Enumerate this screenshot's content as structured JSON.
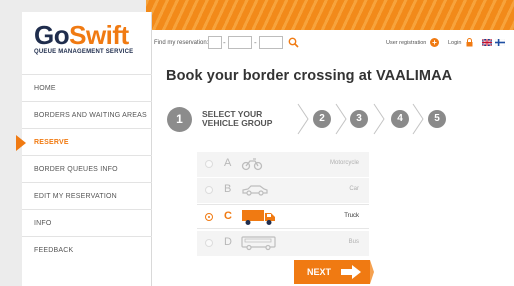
{
  "logo": {
    "go": "Go",
    "swift": "Swift",
    "subtitle": "QUEUE MANAGEMENT SERVICE"
  },
  "colors": {
    "accent": "#f07a12",
    "brand_dark": "#1f2d4d",
    "stripe_light": "#f7a33c"
  },
  "menu": {
    "items": [
      {
        "label": "HOME",
        "active": false
      },
      {
        "label": "BORDERS AND WAITING AREAS",
        "active": false
      },
      {
        "label": "RESERVE",
        "active": true
      },
      {
        "label": "BORDER QUEUES INFO",
        "active": false
      },
      {
        "label": "EDIT MY RESERVATION",
        "active": false
      },
      {
        "label": "INFO",
        "active": false
      },
      {
        "label": "FEEDBACK",
        "active": false
      }
    ]
  },
  "header": {
    "find_label": "Find my reservation:",
    "user_registration": "User registration",
    "login": "Login",
    "icons": [
      "search-icon",
      "plus-icon",
      "lock-icon",
      "uk-flag-icon",
      "finnish-flag-icon"
    ]
  },
  "page": {
    "title": "Book your border crossing at VAALIMAA"
  },
  "steps": {
    "current": {
      "number": "1",
      "label_line1": "SELECT YOUR",
      "label_line2": "VEHICLE GROUP"
    },
    "upcoming": [
      "2",
      "3",
      "4",
      "5"
    ]
  },
  "vehicles": [
    {
      "letter": "A",
      "name": "Motorcycle",
      "icon": "motorcycle-icon",
      "selected": false
    },
    {
      "letter": "B",
      "name": "Car",
      "icon": "car-icon",
      "selected": false
    },
    {
      "letter": "C",
      "name": "Truck",
      "icon": "truck-icon",
      "selected": true
    },
    {
      "letter": "D",
      "name": "Bus",
      "icon": "bus-icon",
      "selected": false
    }
  ],
  "next_button": {
    "label": "NEXT"
  }
}
